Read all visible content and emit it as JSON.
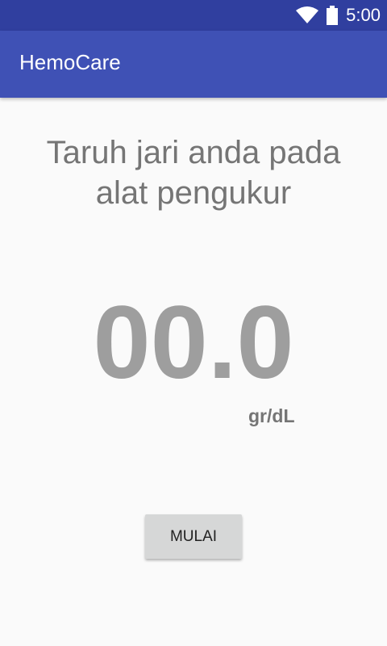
{
  "status_bar": {
    "time": "5:00",
    "icons": [
      "wifi-icon",
      "battery-icon"
    ]
  },
  "app_bar": {
    "title": "HemoCare",
    "color": "#3f51b5",
    "status_color": "#303f9f"
  },
  "main": {
    "instruction_line1": "Taruh jari anda pada",
    "instruction_line2": "alat pengukur",
    "reading_value": "00.0",
    "unit": "gr/dL",
    "start_button_label": "MULAI"
  }
}
